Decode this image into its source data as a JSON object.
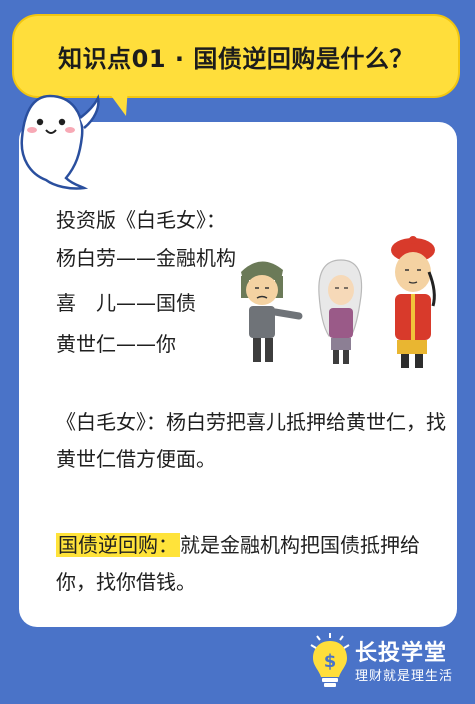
{
  "header": {
    "title": "知识点01 · 国债逆回购是什么？"
  },
  "intro": {
    "heading": "投资版《白毛女》：",
    "mappings": [
      {
        "text": "杨白劳——金融机构"
      },
      {
        "text": "喜　儿——国债"
      },
      {
        "text": "黄世仁——你"
      }
    ]
  },
  "story": {
    "text": "《白毛女》：杨白劳把喜儿抵押给黄世仁，找黄世仁借方便面。"
  },
  "definition": {
    "label": "国债逆回购：",
    "text": "就是金融机构把国债抵押给你，找你借钱。"
  },
  "footer": {
    "brand": "长投学堂",
    "slogan": "理财就是理生活"
  },
  "colors": {
    "background": "#4a73c8",
    "bubble": "#ffde3b",
    "highlight": "#ffe33a"
  },
  "icons": {
    "mascot": "seal-mascot",
    "logo": "lightbulb-icon"
  }
}
